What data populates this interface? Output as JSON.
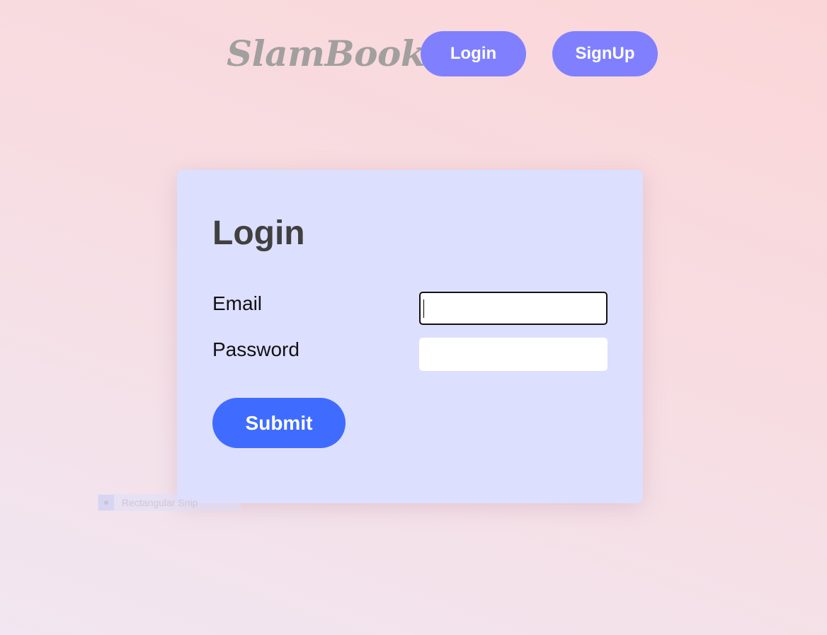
{
  "header": {
    "brand": "SlamBook",
    "nav": {
      "login_label": "Login",
      "signup_label": "SignUp"
    }
  },
  "login_form": {
    "title": "Login",
    "email_label": "Email",
    "email_value": "",
    "password_label": "Password",
    "password_value": "",
    "submit_label": "Submit"
  },
  "overlay": {
    "snip_tooltip_label": "Rectangular Snip",
    "snip_icon": "snip-icon"
  },
  "colors": {
    "nav_button": "#8080ff",
    "submit_button": "#3f6cff",
    "card_background": "#dddfff",
    "brand_text": "#a29f9f",
    "title_text": "#404040"
  }
}
